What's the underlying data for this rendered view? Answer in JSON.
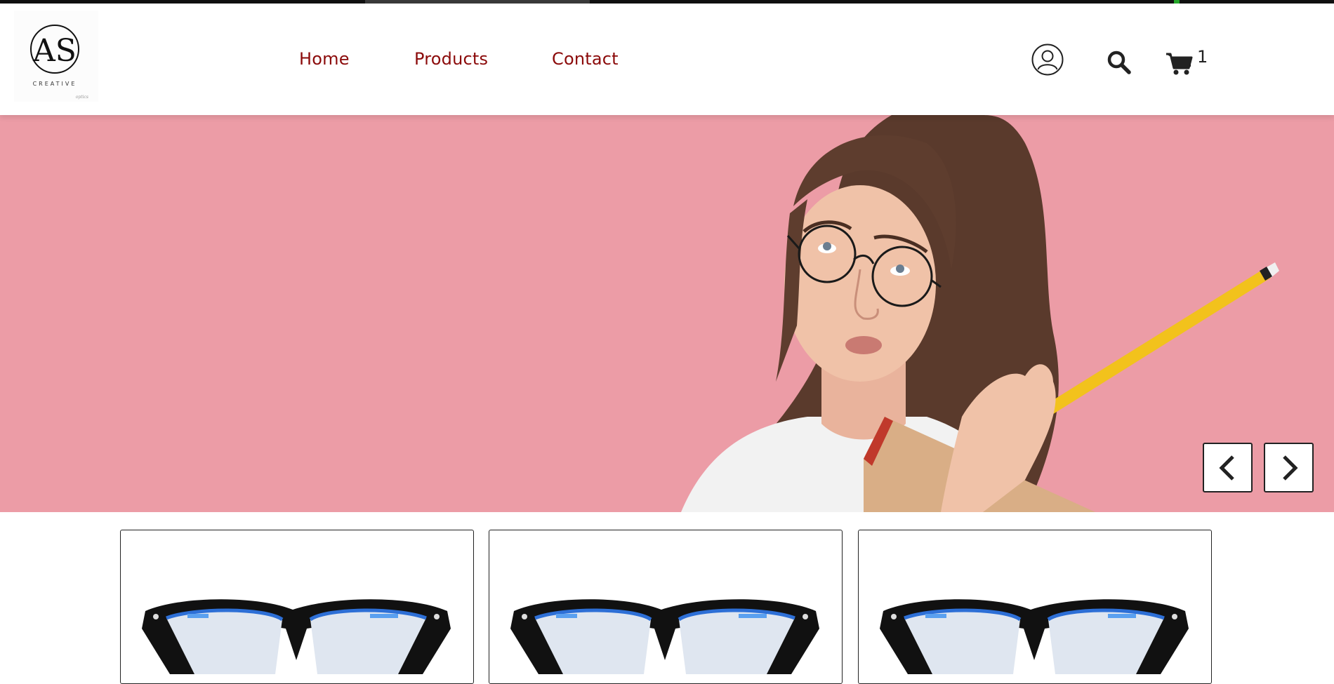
{
  "brand": {
    "monogram": "AS",
    "name": "CREATIVE",
    "tagline": "optics"
  },
  "nav": {
    "items": [
      {
        "label": "Home"
      },
      {
        "label": "Products"
      },
      {
        "label": "Contact"
      }
    ]
  },
  "header_actions": {
    "account_icon": "user-circle-icon",
    "search_icon": "search-icon",
    "cart_icon": "shopping-cart-icon",
    "cart_count": "1"
  },
  "hero": {
    "background_color": "#ec9ca6",
    "image": "woman-with-round-glasses-holding-pencil",
    "controls": {
      "prev_icon": "chevron-left-icon",
      "next_icon": "chevron-right-icon"
    }
  },
  "products": [
    {
      "image": "black-blue-eyeglasses"
    },
    {
      "image": "black-blue-eyeglasses"
    },
    {
      "image": "black-blue-eyeglasses"
    }
  ],
  "colors": {
    "nav_text": "#8b0a0a",
    "accent_pink": "#ec9ca6"
  }
}
